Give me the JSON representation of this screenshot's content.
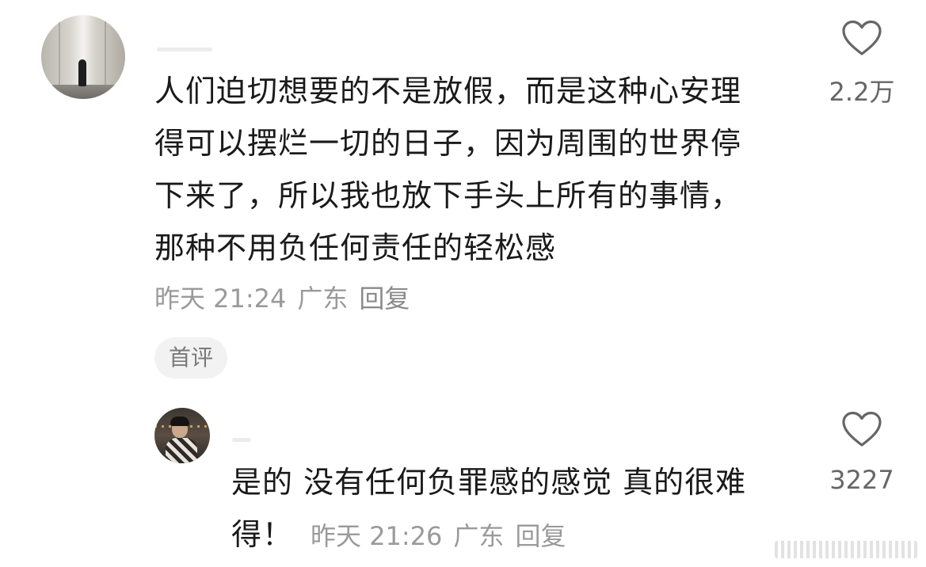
{
  "main_comment": {
    "lines": [
      "人们迫切想要的不是放假，而是这种心安理",
      "得可以摆烂一切的日子，因为周围的世界停",
      "下来了，所以我也放下手头上所有的事情，",
      "那种不用负任何责任的轻松感"
    ],
    "meta": {
      "time": "昨天 21:24",
      "location": "广东",
      "reply_label": "回复"
    },
    "tag": "首评",
    "likes": "2.2万",
    "like_icon": "heart-outline-icon"
  },
  "reply_comment": {
    "text_line1": "是的 没有任何负罪感的感觉 真的很难",
    "text_line2": "得！",
    "meta": {
      "time": "昨天 21:26",
      "location": "广东",
      "reply_label": "回复"
    },
    "likes": "3227",
    "like_icon": "heart-outline-icon"
  },
  "colors": {
    "text_primary": "#1a1a1a",
    "text_meta": "#9a9a9a",
    "tag_bg": "#f2f2f2",
    "heart_stroke": "#666666"
  }
}
